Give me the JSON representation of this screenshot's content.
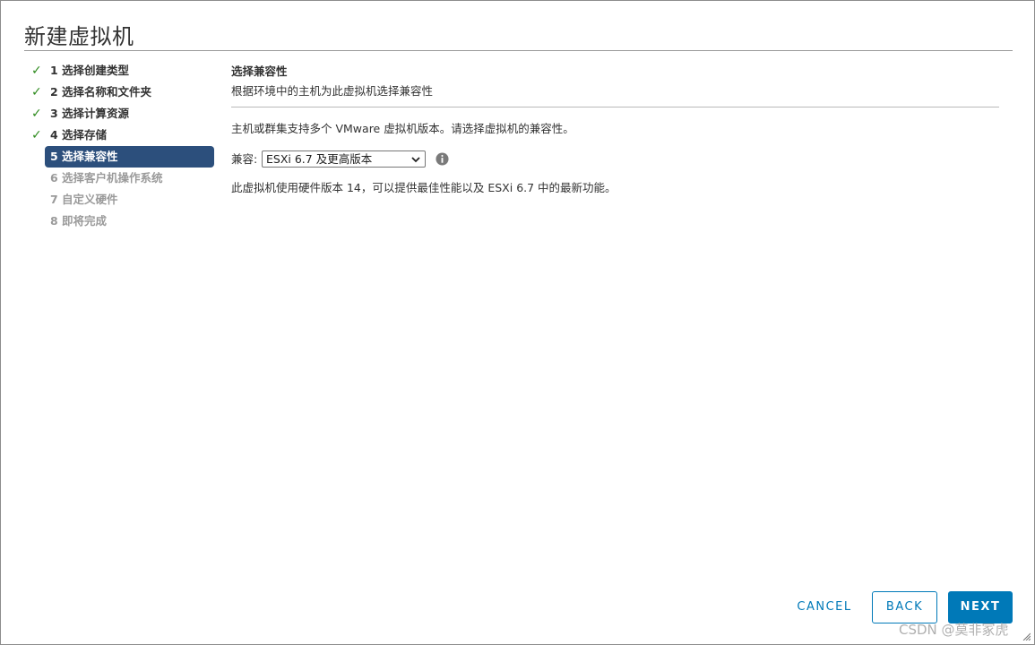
{
  "dialog": {
    "title": "新建虚拟机"
  },
  "steps": [
    {
      "label": "1 选择创建类型",
      "status": "done"
    },
    {
      "label": "2 选择名称和文件夹",
      "status": "done"
    },
    {
      "label": "3 选择计算资源",
      "status": "done"
    },
    {
      "label": "4 选择存储",
      "status": "done"
    },
    {
      "label": "5 选择兼容性",
      "status": "active"
    },
    {
      "label": "6 选择客户机操作系统",
      "status": "pending"
    },
    {
      "label": "7 自定义硬件",
      "status": "pending"
    },
    {
      "label": "8 即将完成",
      "status": "pending"
    }
  ],
  "content": {
    "section_title": "选择兼容性",
    "section_subtitle": "根据环境中的主机为此虚拟机选择兼容性",
    "description": "主机或群集支持多个 VMware 虚拟机版本。请选择虚拟机的兼容性。",
    "compat_label": "兼容:",
    "compat_value": "ESXi 6.7 及更高版本",
    "note": "此虚拟机使用硬件版本 14，可以提供最佳性能以及 ESXi 6.7 中的最新功能。"
  },
  "buttons": {
    "cancel": "CANCEL",
    "back": "BACK",
    "next": "NEXT"
  },
  "watermark": "CSDN @莫非冢虎",
  "colors": {
    "accent": "#0079b8",
    "active_step": "#2c4f7c",
    "check": "#2e8b1e"
  },
  "icons": {
    "done": "check-icon",
    "info": "info-icon",
    "select": "chevron-down-icon",
    "resize": "resize-grip-icon"
  }
}
